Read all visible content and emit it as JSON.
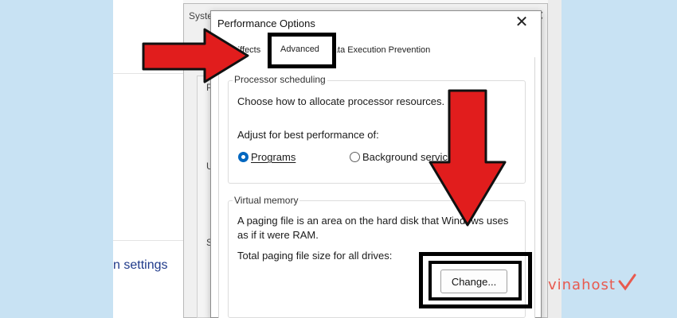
{
  "background": {
    "system_properties_title": "Syste",
    "sidebar_letters": [
      "P",
      "U",
      "S"
    ],
    "settings_link": "n settings"
  },
  "dialog": {
    "title": "Performance Options",
    "close_glyph": "✕",
    "tabs": [
      {
        "label": "Visual Effects",
        "selected": false
      },
      {
        "label": "Advanced",
        "selected": true
      },
      {
        "label": "Data Execution Prevention",
        "selected": false
      }
    ],
    "processor_scheduling": {
      "group_label": "Processor scheduling",
      "description": "Choose how to allocate processor resources.",
      "adjust_label": "Adjust for best performance of:",
      "options": [
        {
          "label": "Programs",
          "selected": true
        },
        {
          "label": "Background services",
          "selected": false
        }
      ]
    },
    "virtual_memory": {
      "group_label": "Virtual memory",
      "description_line1": "A paging file is an area on the hard disk that Windows uses",
      "description_line2": "as if it were RAM.",
      "total_label": "Total paging file size for all drives:",
      "change_button": "Change..."
    }
  },
  "annotations": {
    "arrow_color": "#e11d1d",
    "arrow_outline": "#111111",
    "highlight_color": "#000000"
  },
  "watermark": {
    "text": "vinahost",
    "brand_color": "#e85a4f"
  }
}
